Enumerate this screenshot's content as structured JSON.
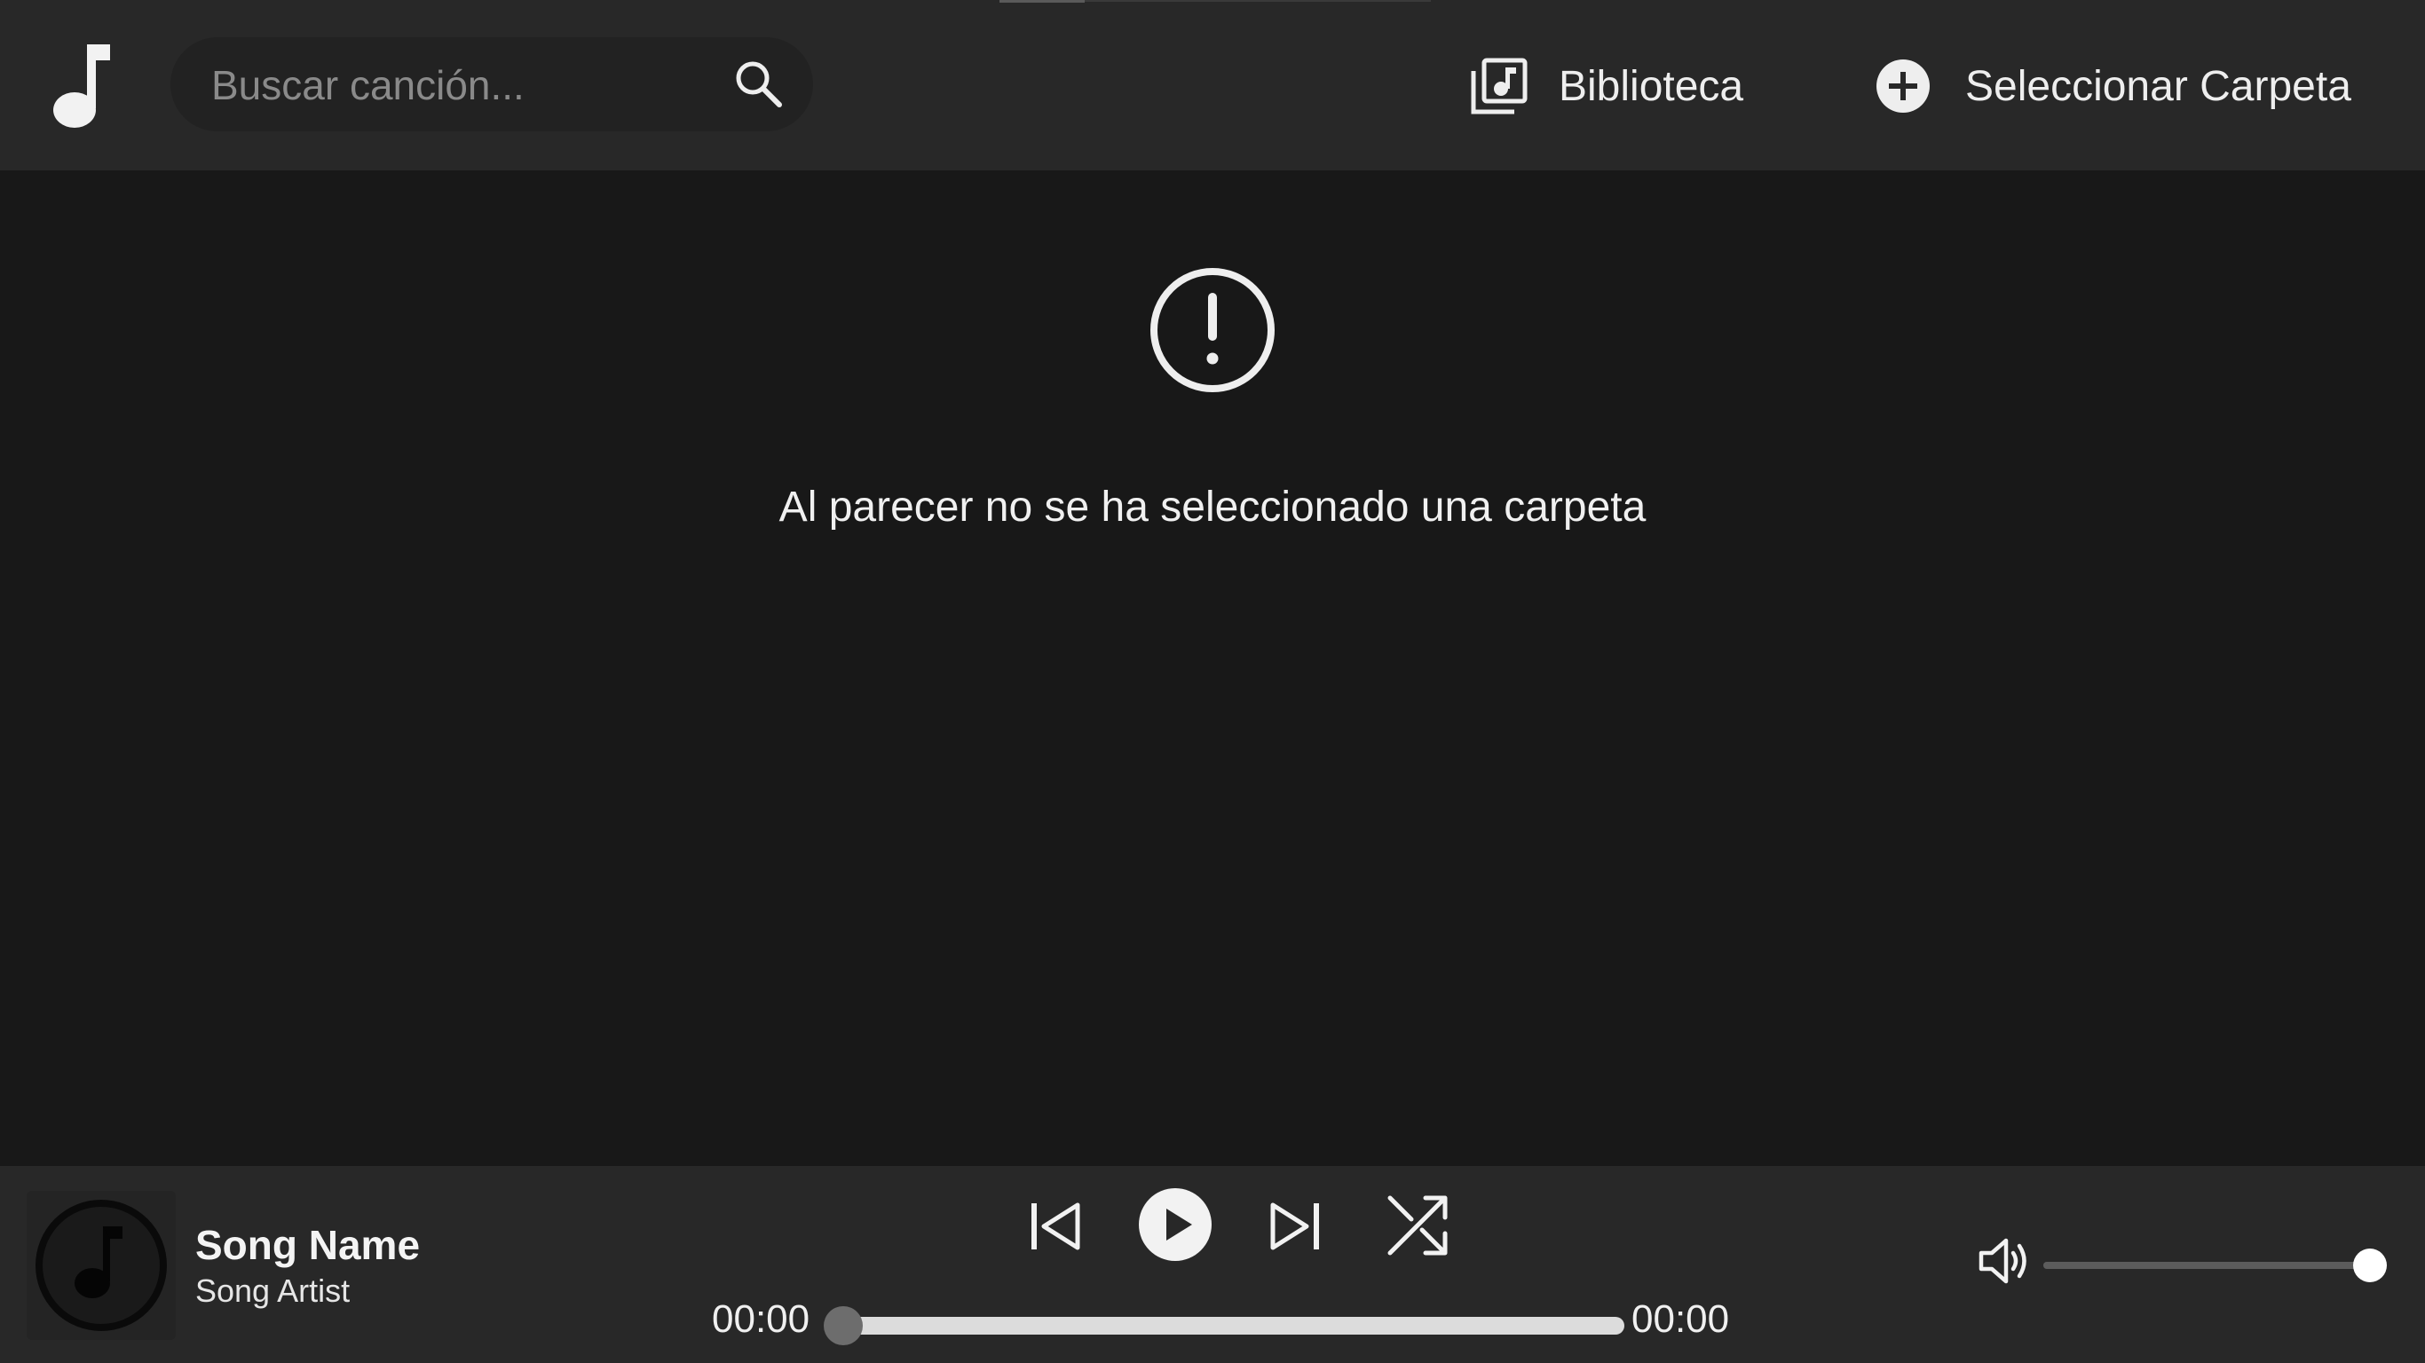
{
  "header": {
    "search": {
      "placeholder": "Buscar canción...",
      "value": ""
    },
    "nav": {
      "library_label": "Biblioteca",
      "select_folder_label": "Seleccionar Carpeta"
    }
  },
  "main": {
    "empty_message": "Al parecer no se ha seleccionado una carpeta"
  },
  "player": {
    "song_name": "Song Name",
    "song_artist": "Song Artist",
    "time_current": "00:00",
    "time_total": "00:00",
    "progress_fraction": 0.0,
    "volume_fraction": 1.0
  },
  "icons": {
    "logo": "music-note-icon",
    "search": "search-icon",
    "library": "music-library-icon",
    "select_folder": "plus-circle-icon",
    "empty_state": "alert-circle-icon",
    "cover": "music-disc-icon",
    "prev": "skip-previous-icon",
    "play": "play-icon",
    "next": "skip-next-icon",
    "shuffle": "shuffle-icon",
    "volume": "volume-icon"
  },
  "colors": {
    "background": "#181818",
    "bars": "#282828",
    "search_background": "#222222",
    "text": "#f0f0f0",
    "placeholder": "#8a8a8a"
  }
}
